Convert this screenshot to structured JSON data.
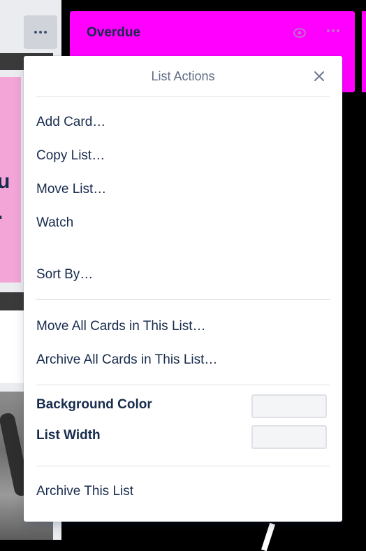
{
  "board": {
    "left_list": {
      "card_text": "u\n."
    },
    "overdue_list": {
      "title": "Overdue"
    }
  },
  "popover": {
    "title": "List Actions",
    "close_icon": "close-icon",
    "actions_group1": [
      "Add Card…",
      "Copy List…",
      "Move List…",
      "Watch"
    ],
    "sort_by": "Sort By…",
    "actions_group2": [
      "Move All Cards in This List…",
      "Archive All Cards in This List…"
    ],
    "background_color_label": "Background Color",
    "list_width_label": "List Width",
    "archive_list": "Archive This List"
  },
  "colors": {
    "overdue_list": "#ff00ff",
    "text_primary": "#172b4d",
    "text_muted": "#5e6c84",
    "pink_card": "#f2a5d6"
  }
}
